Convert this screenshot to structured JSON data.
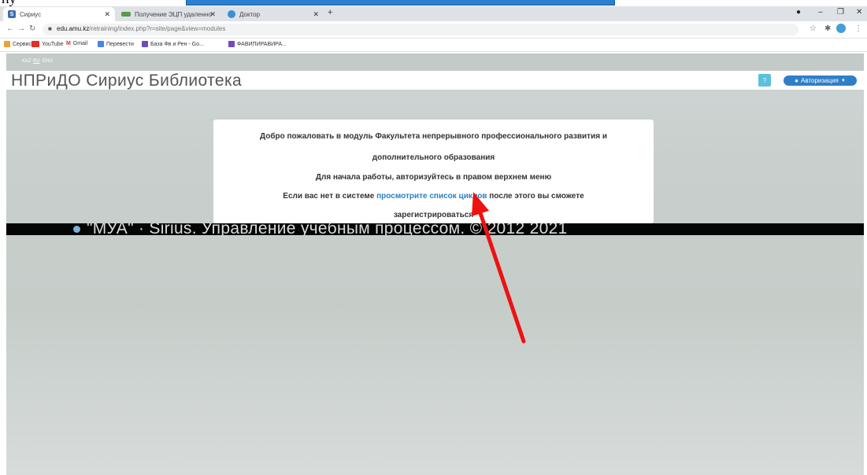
{
  "browser": {
    "tabs": [
      {
        "title": "Сириус",
        "icon": "S"
      },
      {
        "title": "Получение ЭЦП удаленно | Зе",
        "icon": ""
      },
      {
        "title": "Доктор",
        "icon": ""
      }
    ],
    "new_tab": "+",
    "window_controls": {
      "minimize": "–",
      "maximize": "❐",
      "close": "✕"
    },
    "url_host": "edu.amu.kz",
    "url_path": "/retraining/index.php?r=site/page&view=modules",
    "bookmarks": [
      "Сервисы",
      "YouTube",
      "Gmail",
      "Перевести",
      "База Фв и Рен - Go...",
      "ФАВИПИРАВИРА..."
    ]
  },
  "site": {
    "languages": [
      "KAZ",
      "RU",
      "ENG"
    ],
    "title": "НПРиДО  Сириус  Библиотека",
    "help_label": "?",
    "auth_label": "Авторизация"
  },
  "welcome": {
    "line1": "Добро пожаловать в модуль Факультета непрерывного профессионального развития и",
    "line2": "дополнительного образования",
    "line3": "Для начала работы, авторизуйтесь в правом верхнем меню",
    "line4_before": "Если вас нет в системе",
    "line4_link": "просмотрите список циклов",
    "line4_after": "после этого вы сможете",
    "line5": "зарегистрироваться"
  },
  "footer": {
    "text": "\"МУА\" ·  Sirius. Управление учебным процессом. © 2012 2021"
  },
  "colors": {
    "accent_blue": "#2f7fc8",
    "help_blue": "#5bc0de",
    "annotation_arrow": "#ee1111"
  },
  "icons": {
    "back": "←",
    "forward": "→",
    "reload": "↻",
    "lock": "🔒",
    "star": "☆",
    "extensions": "✱",
    "profile": "●",
    "menu": "⋮",
    "apps": "⋮⋮"
  }
}
